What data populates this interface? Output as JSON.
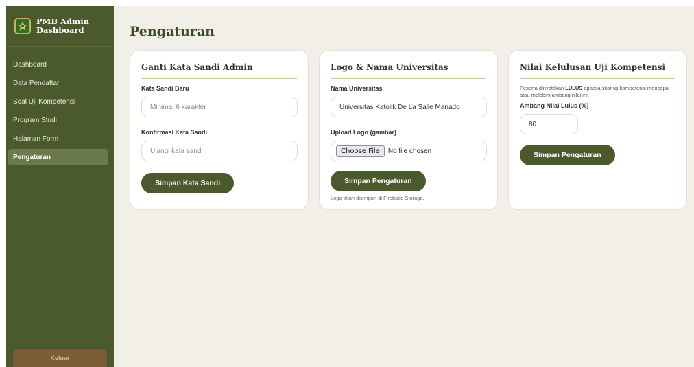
{
  "sidebar": {
    "brand_line1": "PMB Admin",
    "brand_line2": "Dashboard",
    "items": [
      {
        "label": "Dashboard"
      },
      {
        "label": "Data Pendaftar"
      },
      {
        "label": "Soal Uji Kompetensi"
      },
      {
        "label": "Program Studi"
      },
      {
        "label": "Halaman Form"
      },
      {
        "label": "Pengaturan"
      }
    ],
    "active": "Pengaturan",
    "logout_label": "Keluar"
  },
  "page": {
    "title": "Pengaturan"
  },
  "password_card": {
    "title": "Ganti Kata Sandi Admin",
    "new_label": "Kata Sandi Baru",
    "new_placeholder": "Minimal 6 karakter",
    "confirm_label": "Konfirmasi Kata Sandi",
    "confirm_placeholder": "Ulangi kata sandi",
    "button": "Simpan Kata Sandi"
  },
  "university_card": {
    "title": "Logo & Nama Universitas",
    "name_label": "Nama Universitas",
    "name_value": "Universitas Katolik De La Salle Manado",
    "upload_label": "Upload Logo (gambar)",
    "file_button": "Choose File",
    "file_status": "No file chosen",
    "button": "Simpan Pengaturan",
    "note": "Logo akan disimpan di Firebase Storage."
  },
  "pass_card": {
    "title": "Nilai Kelulusan Uji Kompetensi",
    "desc_pre": "Peserta dinyatakan ",
    "desc_bold": "LULUS",
    "desc_post": " apabila skor uji kompetensi mencapai atau melebihi ambang nilai ini.",
    "threshold_label": "Ambang Nilai Lulus (%)",
    "threshold_value": "80",
    "button": "Simpan Pengaturan"
  },
  "colors": {
    "sidebar_bg": "#4a5a2c",
    "accent": "#4a5a2c",
    "page_bg": "#f2efe8",
    "logout_bg": "#7a5c36"
  }
}
